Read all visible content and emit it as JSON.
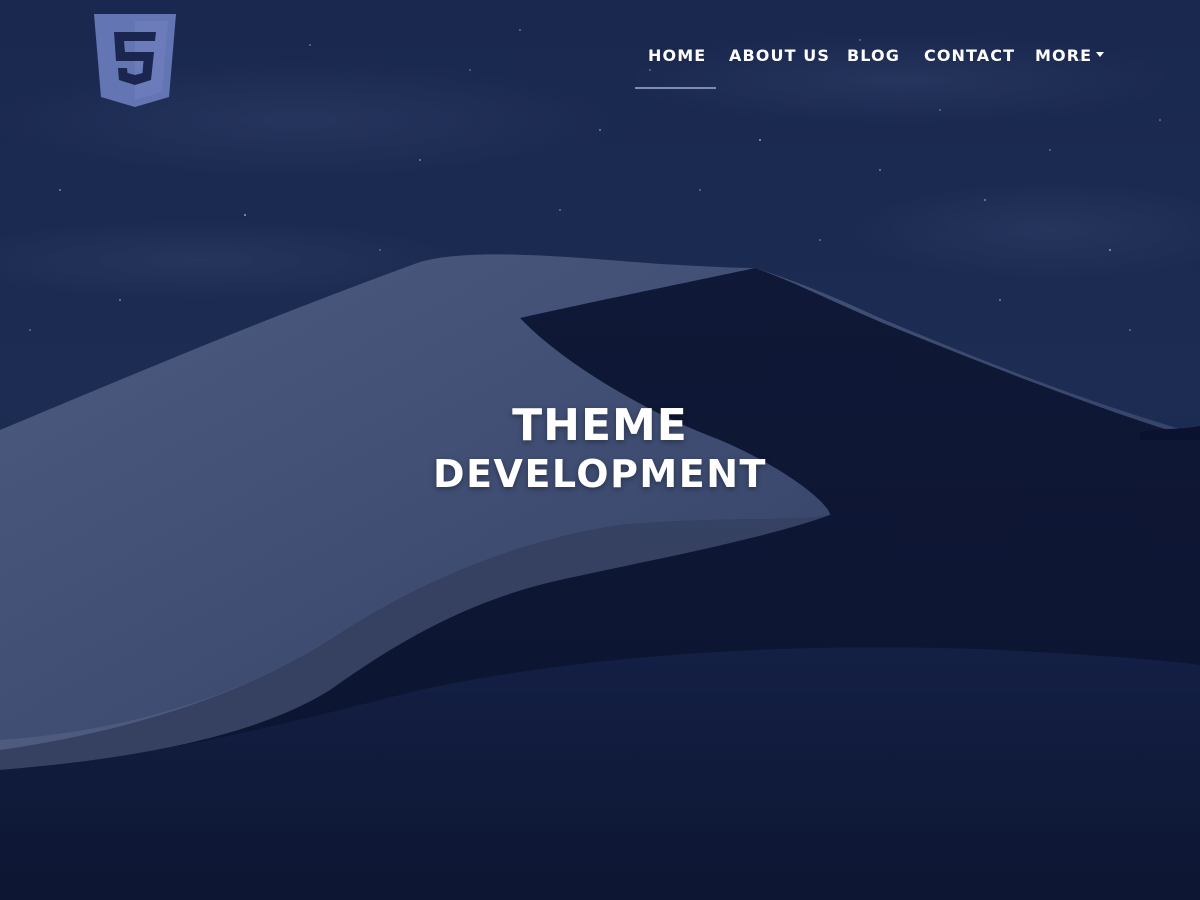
{
  "header": {
    "logo_icon": "html5-logo-icon"
  },
  "nav": {
    "items": [
      {
        "label": "HOME",
        "active": true
      },
      {
        "label": "ABOUT US"
      },
      {
        "label": "BLOG"
      },
      {
        "label": "CONTACT"
      },
      {
        "label": "MORE"
      }
    ]
  },
  "hero": {
    "line1": "THEME",
    "line2": "DEVELOPMENT"
  },
  "colors": {
    "logo": "#6475b3",
    "active_underline": "#7d8db8",
    "text": "#ffffff",
    "sky": "#1b2a4e"
  }
}
